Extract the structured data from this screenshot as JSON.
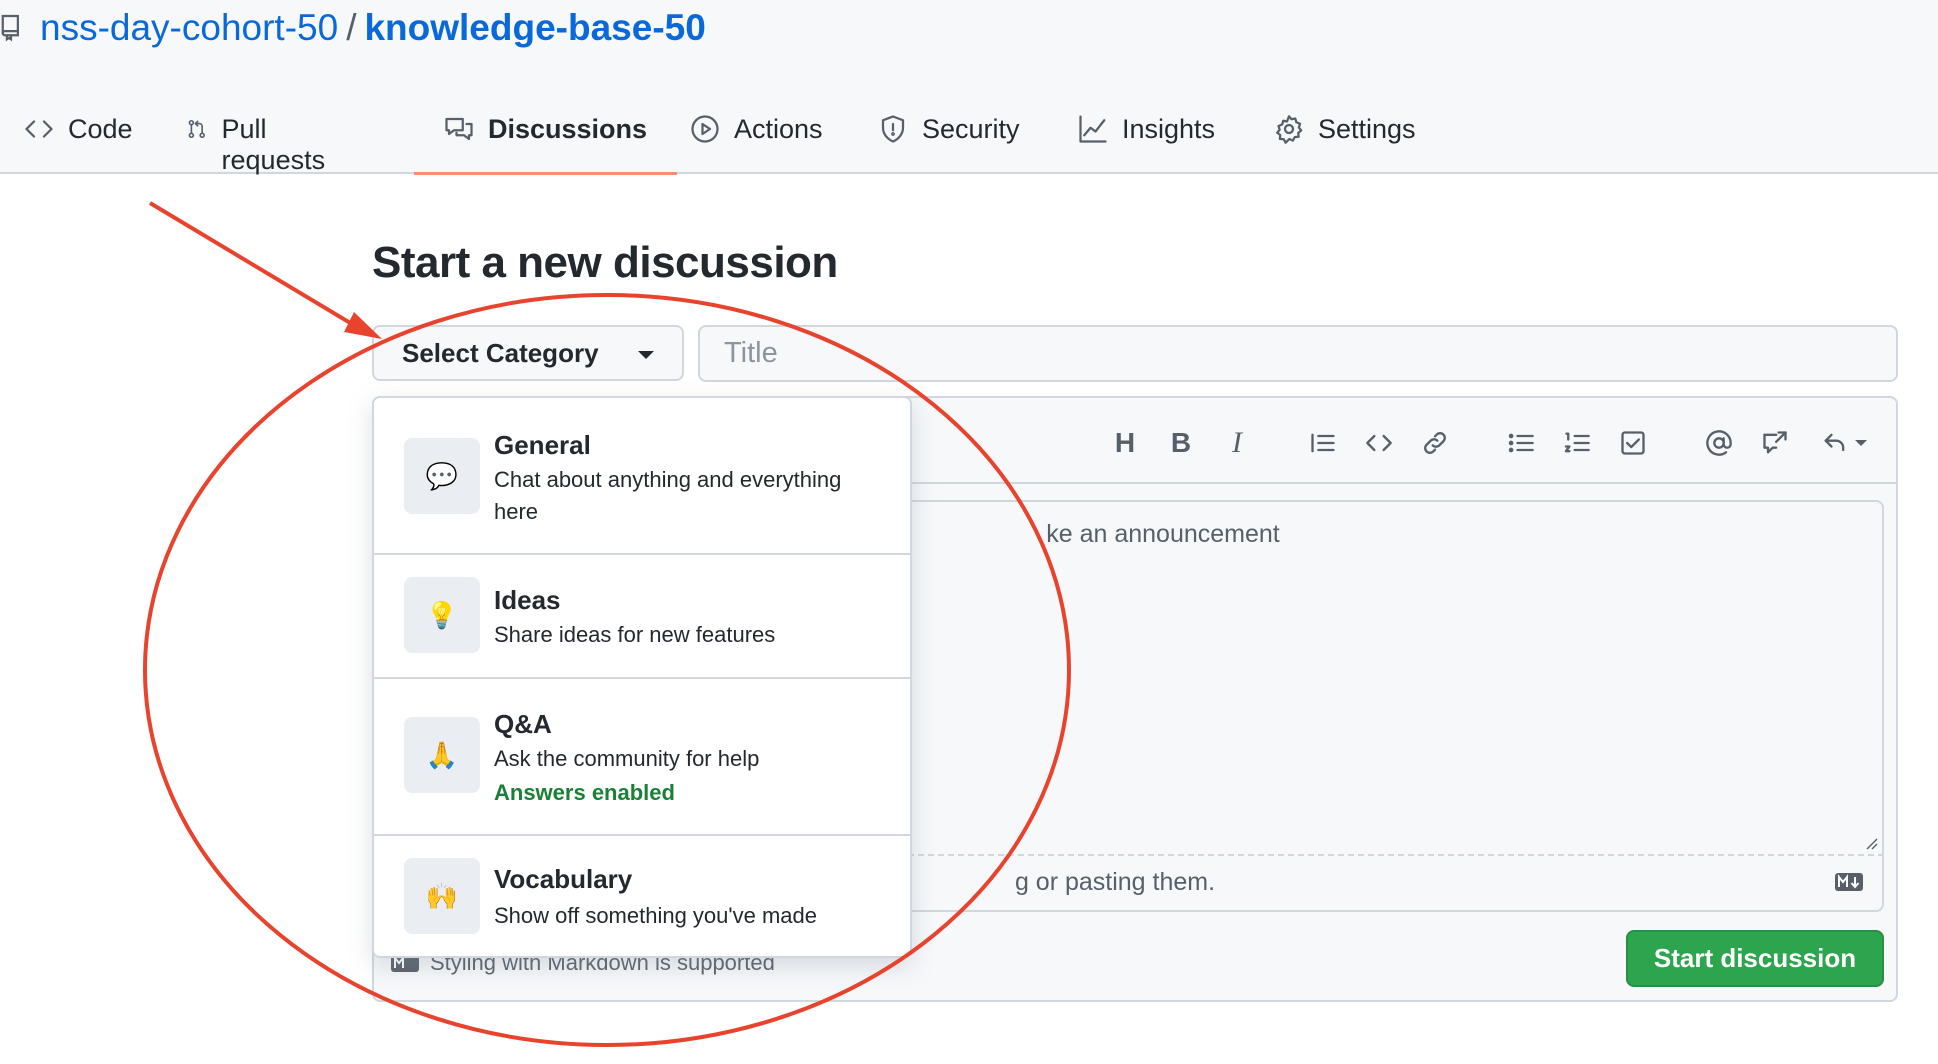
{
  "repo": {
    "owner": "nss-day-cohort-50",
    "separator": "/",
    "name": "knowledge-base-50"
  },
  "tabs": [
    {
      "label": "Code",
      "icon": "code-icon"
    },
    {
      "label": "Pull requests",
      "icon": "pull-request-icon"
    },
    {
      "label": "Discussions",
      "icon": "discussions-icon",
      "active": true
    },
    {
      "label": "Actions",
      "icon": "play-icon"
    },
    {
      "label": "Security",
      "icon": "shield-icon"
    },
    {
      "label": "Insights",
      "icon": "graph-icon"
    },
    {
      "label": "Settings",
      "icon": "gear-icon"
    }
  ],
  "page": {
    "title": "Start a new discussion"
  },
  "form": {
    "category_label": "Select Category",
    "title_placeholder": "Title",
    "body_placeholder_visible": "ke an announcement",
    "attach_hint_visible": "g or pasting them.",
    "markdown_note": "Styling with Markdown is supported",
    "submit_label": "Start discussion"
  },
  "toolbar": {
    "icons": [
      "heading-icon",
      "bold-icon",
      "italic-icon",
      "quote-icon",
      "code-icon",
      "link-icon",
      "bulleted-list-icon",
      "numbered-list-icon",
      "task-list-icon",
      "mention-icon",
      "cross-reference-icon",
      "reply-icon"
    ],
    "heading": "H",
    "bold": "B",
    "italic": "I"
  },
  "categories": [
    {
      "name": "General",
      "emoji": "💬",
      "description": "Chat about anything and everything here",
      "extra": ""
    },
    {
      "name": "Ideas",
      "emoji": "💡",
      "description": "Share ideas for new features",
      "extra": ""
    },
    {
      "name": "Q&A",
      "emoji": "🙏",
      "description": "Ask the community for help",
      "extra": "Answers enabled"
    },
    {
      "name": "Vocabulary",
      "emoji": "🙌",
      "description": "Show off something you've made",
      "extra": ""
    }
  ],
  "colors": {
    "link": "#0969da",
    "active_underline": "#fd8c73",
    "primary_button": "#2da44e",
    "answers_enabled": "#1a7f37",
    "annotation": "#e8432d"
  }
}
